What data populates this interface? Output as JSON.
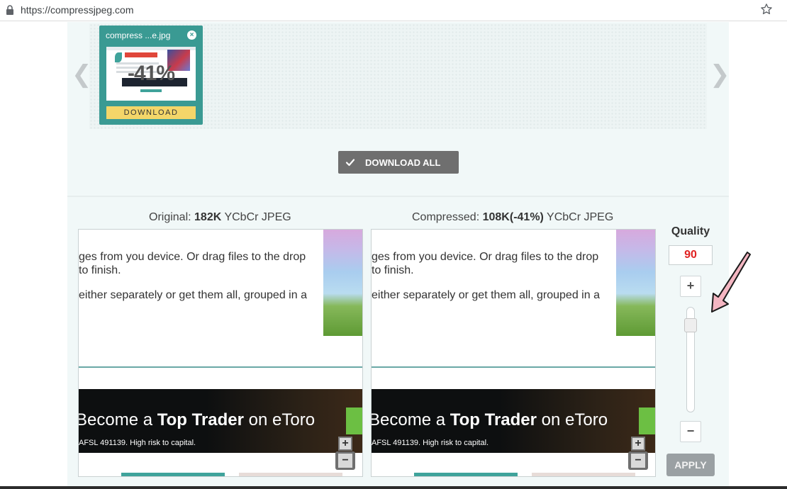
{
  "browser": {
    "url": "https://compressjpeg.com",
    "icons": {
      "lock": "lock-icon",
      "bookmark": "star-icon"
    }
  },
  "carousel": {
    "prev_glyph": "❮",
    "next_glyph": "❯",
    "thumbnail": {
      "filename": "compress ...e.jpg",
      "close_glyph": "×",
      "savings": "-41%",
      "download_label": "DOWNLOAD"
    }
  },
  "actions": {
    "download_all_label": "DOWNLOAD ALL"
  },
  "comparison": {
    "original": {
      "caption_prefix": "Original:",
      "size": "182K",
      "format": "YCbCr JPEG",
      "lines": [
        "ges from you device. Or drag files to the drop",
        "to finish.",
        "either separately or get them all, grouped in a"
      ]
    },
    "compressed": {
      "caption_prefix": "Compressed:",
      "size": "108K(-41%)",
      "format": "YCbCr JPEG",
      "lines": [
        "ges from you device. Or drag files to the drop",
        "to finish.",
        "either separately or get them all, grouped in a"
      ]
    },
    "ad": {
      "prefix": "Become a",
      "bold": "Top Trader",
      "suffix": "on eToro",
      "disclaimer": "AFSL 491139. High risk to capital."
    },
    "zoom": {
      "in": "+",
      "out": "−"
    }
  },
  "quality": {
    "label": "Quality",
    "value": "90",
    "level_percent": 90,
    "increment": "+",
    "decrement": "−",
    "apply_label": "APPLY"
  },
  "colors": {
    "accent_teal": "#3a9a93",
    "download_yellow": "#f4d669",
    "quality_value_red": "#e02222",
    "annotation_pink": "#f4b6c2"
  }
}
